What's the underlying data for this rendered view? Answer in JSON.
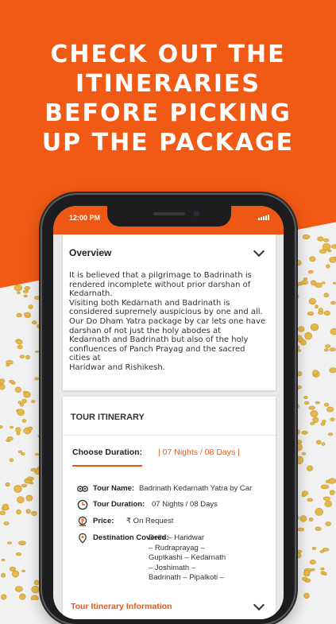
{
  "headline": {
    "line1": "CHECK OUT THE",
    "line2": "ITINERARIES",
    "line3": "BEFORE PICKING",
    "line4": "UP THE PACKAGE"
  },
  "colors": {
    "accent": "#ee5714",
    "background_orange": "#f05a14",
    "coin": "#e4b84a"
  },
  "status_bar": {
    "time": "12:00 PM",
    "signal_icon": "signal-icon"
  },
  "overview": {
    "title": "Overview",
    "text": "It is believed that a pilgrimage to Badrinath is\nrendered incomplete without prior darshan of\nKedarnath.\nVisiting both Kedarnath and Badrinath is\nconsidered supremely auspicious by one and all.\nOur Do Dham Yatra package by car lets one have\ndarshan of not just the holy abodes at\nKedarnath and Badrinath but also of the holy\nconfluences of Panch Prayag and the sacred\ncities at\nHaridwar and Rishikesh.",
    "toggle_icon": "chevron-down-icon"
  },
  "tour_itinerary": {
    "title": "TOUR ITINERARY",
    "choose_duration_label": "Choose Duration:",
    "duration_value": "| 07 Nights / 08 Days |",
    "details": {
      "tour_name_label": "Tour Name:",
      "tour_name_value": "Badrinath Kedarnath Yatra by Car",
      "tour_duration_label": "Tour Duration:",
      "tour_duration_value": "07 Nights / 08 Days",
      "price_label": "Price:",
      "price_value": "₹ On Request",
      "destination_label": "Destination Covered:",
      "destination_value": "Delhi – Haridwar\n– Rudraprayag –\nGuptkashi – Kedarnath\n– Joshimath –\nBadrinath – Pipalkoti –"
    },
    "info_section_title": "Tour Itinerary Information"
  }
}
